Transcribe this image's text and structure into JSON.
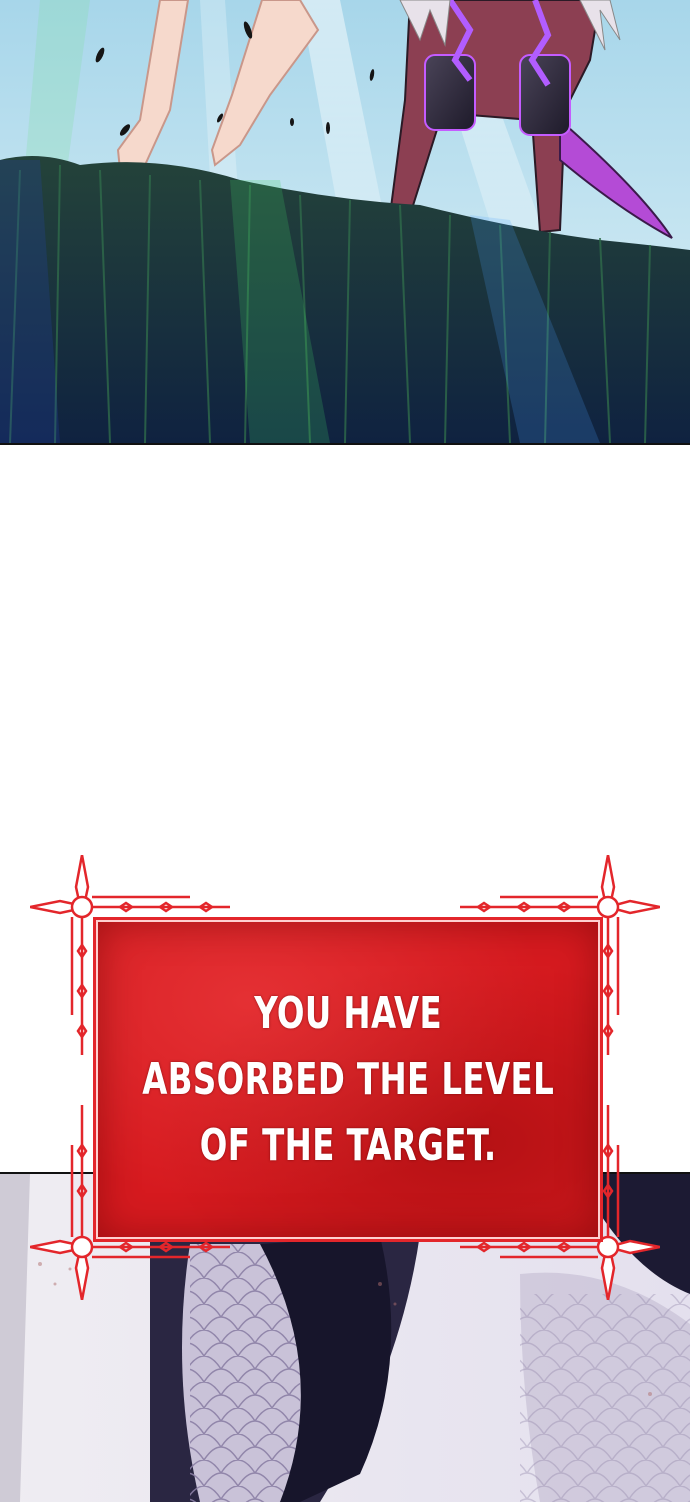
{
  "system_message": {
    "lines": [
      "YOU HAVE",
      "ABSORBED THE LEVEL",
      "OF THE TARGET."
    ]
  },
  "colors": {
    "frame_red": "#e3262b",
    "box_red": "#d61a1f",
    "text": "#ffffff"
  }
}
